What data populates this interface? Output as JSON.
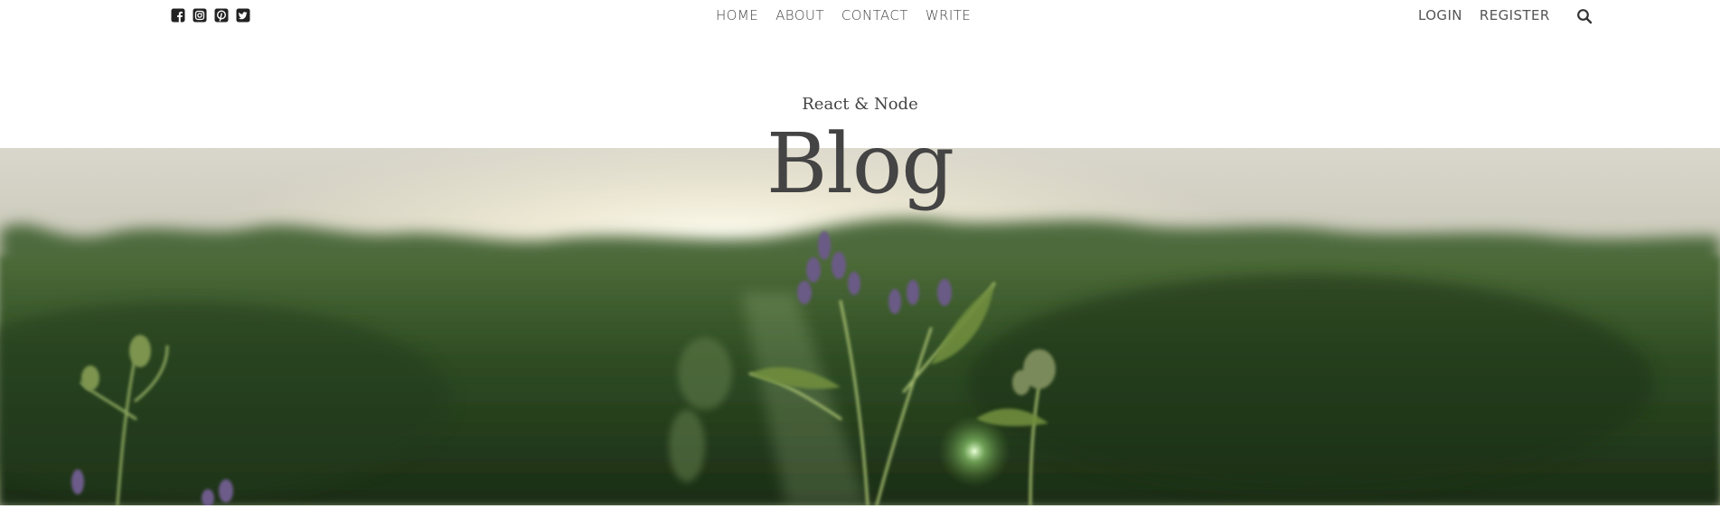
{
  "social": {
    "icons": [
      "facebook-square-icon",
      "instagram-square-icon",
      "pinterest-square-icon",
      "twitter-square-icon"
    ]
  },
  "nav": {
    "items": [
      {
        "label": "HOME"
      },
      {
        "label": "ABOUT"
      },
      {
        "label": "CONTACT"
      },
      {
        "label": "WRITE"
      }
    ]
  },
  "auth": {
    "login": "LOGIN",
    "register": "REGISTER"
  },
  "header": {
    "subtitle": "React & Node",
    "title": "Blog"
  },
  "hero": {
    "image": "flower-field-sunset-photo"
  },
  "colors": {
    "text": "#444444",
    "background": "#ffffff"
  }
}
